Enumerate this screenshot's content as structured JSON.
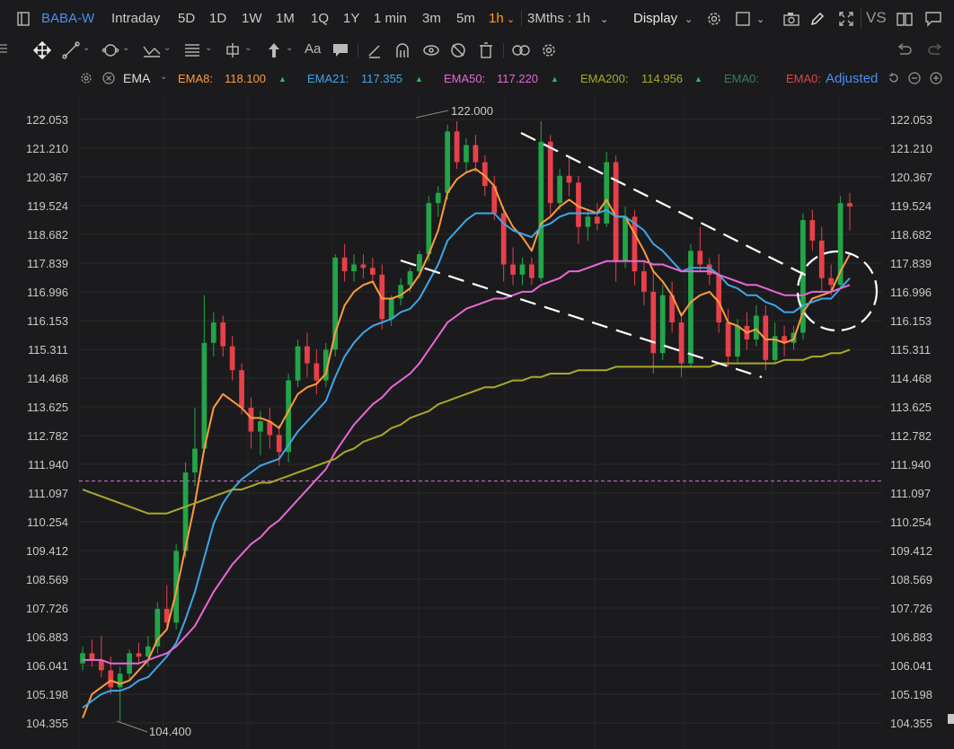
{
  "header": {
    "ticker": "BABA-W",
    "periods": [
      "Intraday",
      "5D",
      "1D",
      "1W",
      "1M",
      "1Q",
      "1Y",
      "1 min",
      "3m",
      "5m"
    ],
    "active_period": "1h",
    "range": "3Mths : 1h",
    "display": "Display",
    "vs": "VS"
  },
  "indicators": {
    "name": "EMA",
    "items": [
      {
        "label": "EMA8:",
        "value": "118.100",
        "color": "#ff9a3c"
      },
      {
        "label": "EMA21:",
        "value": "117.355",
        "color": "#3ea6e8"
      },
      {
        "label": "EMA50:",
        "value": "117.220",
        "color": "#e868d6"
      },
      {
        "label": "EMA200:",
        "value": "114.956",
        "color": "#a8a82a"
      }
    ],
    "extra1": "EMA0:",
    "extra2": "EMA0:",
    "adjusted": "Adjusted"
  },
  "axis": {
    "labels": [
      "122.053",
      "121.210",
      "120.367",
      "119.524",
      "118.682",
      "117.839",
      "116.996",
      "116.153",
      "115.311",
      "114.468",
      "113.625",
      "112.782",
      "111.940",
      "111.097",
      "110.254",
      "109.412",
      "108.569",
      "107.726",
      "106.883",
      "106.041",
      "105.198",
      "104.355"
    ]
  },
  "annotations": {
    "high": "122.000",
    "low": "104.400"
  },
  "chart_data": {
    "type": "candlestick",
    "y_range": [
      104.355,
      122.053
    ],
    "candles": [
      [
        106.1,
        106.6,
        105.9,
        106.4
      ],
      [
        106.4,
        106.8,
        106.0,
        106.2
      ],
      [
        106.2,
        106.9,
        105.7,
        105.9
      ],
      [
        105.9,
        106.3,
        105.2,
        105.4
      ],
      [
        105.4,
        106.0,
        104.4,
        105.8
      ],
      [
        105.8,
        106.5,
        105.6,
        106.4
      ],
      [
        106.4,
        106.7,
        106.1,
        106.3
      ],
      [
        106.3,
        106.9,
        106.0,
        106.6
      ],
      [
        106.6,
        107.9,
        106.4,
        107.7
      ],
      [
        107.7,
        108.4,
        107.2,
        107.3
      ],
      [
        107.3,
        109.6,
        107.1,
        109.4
      ],
      [
        109.4,
        112.0,
        109.2,
        111.7
      ],
      [
        111.7,
        113.6,
        111.3,
        112.4
      ],
      [
        112.4,
        116.9,
        112.3,
        115.5
      ],
      [
        115.5,
        116.4,
        115.1,
        116.1
      ],
      [
        116.1,
        116.3,
        115.1,
        115.4
      ],
      [
        115.4,
        115.7,
        114.4,
        114.7
      ],
      [
        114.7,
        114.9,
        113.4,
        113.6
      ],
      [
        113.6,
        113.9,
        112.4,
        112.9
      ],
      [
        112.9,
        113.5,
        112.2,
        113.2
      ],
      [
        113.2,
        113.6,
        112.4,
        112.8
      ],
      [
        112.8,
        113.1,
        111.9,
        112.3
      ],
      [
        112.3,
        114.6,
        112.0,
        114.4
      ],
      [
        114.4,
        115.6,
        114.2,
        115.4
      ],
      [
        115.4,
        115.8,
        114.5,
        114.9
      ],
      [
        114.9,
        115.3,
        114.0,
        114.4
      ],
      [
        114.4,
        115.5,
        114.2,
        115.3
      ],
      [
        115.3,
        118.1,
        115.1,
        118.0
      ],
      [
        118.0,
        118.4,
        117.3,
        117.6
      ],
      [
        117.6,
        118.1,
        117.3,
        117.8
      ],
      [
        117.8,
        118.1,
        117.4,
        117.7
      ],
      [
        117.7,
        118.0,
        117.3,
        117.5
      ],
      [
        117.5,
        117.8,
        115.9,
        116.2
      ],
      [
        116.2,
        116.9,
        116.0,
        116.8
      ],
      [
        116.8,
        117.4,
        116.6,
        117.2
      ],
      [
        117.2,
        117.7,
        117.0,
        117.6
      ],
      [
        117.6,
        118.2,
        117.4,
        118.1
      ],
      [
        118.1,
        119.8,
        117.9,
        119.6
      ],
      [
        119.6,
        120.1,
        119.2,
        119.9
      ],
      [
        119.9,
        121.9,
        119.7,
        121.7
      ],
      [
        121.7,
        122.0,
        120.6,
        120.8
      ],
      [
        120.8,
        121.5,
        120.5,
        121.3
      ],
      [
        121.3,
        121.6,
        120.5,
        120.8
      ],
      [
        120.8,
        121.0,
        119.8,
        120.1
      ],
      [
        120.1,
        120.4,
        119.1,
        119.3
      ],
      [
        119.3,
        119.5,
        117.3,
        117.8
      ],
      [
        117.8,
        118.3,
        117.2,
        117.5
      ],
      [
        117.5,
        118.0,
        117.2,
        117.8
      ],
      [
        117.8,
        118.0,
        117.2,
        117.4
      ],
      [
        117.4,
        122.0,
        117.3,
        121.4
      ],
      [
        121.4,
        121.6,
        119.2,
        119.6
      ],
      [
        119.6,
        120.6,
        119.4,
        120.4
      ],
      [
        120.4,
        121.0,
        119.8,
        120.2
      ],
      [
        120.2,
        120.4,
        118.4,
        118.9
      ],
      [
        118.9,
        119.4,
        118.5,
        119.2
      ],
      [
        119.2,
        119.6,
        118.8,
        119.0
      ],
      [
        119.0,
        121.1,
        118.9,
        120.8
      ],
      [
        120.8,
        121.0,
        117.3,
        117.9
      ],
      [
        117.9,
        119.5,
        117.7,
        119.2
      ],
      [
        119.2,
        119.4,
        117.2,
        117.6
      ],
      [
        117.6,
        117.9,
        116.6,
        117.0
      ],
      [
        117.0,
        117.6,
        114.6,
        115.2
      ],
      [
        115.2,
        117.2,
        115.0,
        116.9
      ],
      [
        116.9,
        117.3,
        115.8,
        116.1
      ],
      [
        116.1,
        116.4,
        114.5,
        114.9
      ],
      [
        114.9,
        118.4,
        114.8,
        118.2
      ],
      [
        118.2,
        118.9,
        117.6,
        117.8
      ],
      [
        117.8,
        118.0,
        117.2,
        117.5
      ],
      [
        117.5,
        118.1,
        115.8,
        116.1
      ],
      [
        116.1,
        116.5,
        114.8,
        115.1
      ],
      [
        115.1,
        116.2,
        114.9,
        116.0
      ],
      [
        116.0,
        116.4,
        115.3,
        115.6
      ],
      [
        115.6,
        116.6,
        115.4,
        116.3
      ],
      [
        116.3,
        116.6,
        114.7,
        115.0
      ],
      [
        115.0,
        116.1,
        114.9,
        115.7
      ],
      [
        115.7,
        116.0,
        115.1,
        115.5
      ],
      [
        115.5,
        116.0,
        115.3,
        115.8
      ],
      [
        115.8,
        119.3,
        115.6,
        119.1
      ],
      [
        119.1,
        119.4,
        118.2,
        118.5
      ],
      [
        118.5,
        118.9,
        117.0,
        117.4
      ],
      [
        117.4,
        117.8,
        116.9,
        117.2
      ],
      [
        117.2,
        119.8,
        117.1,
        119.6
      ],
      [
        119.6,
        119.9,
        118.8,
        119.5
      ]
    ],
    "series": [
      {
        "name": "EMA8",
        "values": [
          104.5,
          105.2,
          105.4,
          105.6,
          105.5,
          105.6,
          105.9,
          106.2,
          106.8,
          107.1,
          108.2,
          109.5,
          110.8,
          112.4,
          113.6,
          114.0,
          113.8,
          113.6,
          113.3,
          113.3,
          113.2,
          113.0,
          113.5,
          114.0,
          114.2,
          114.3,
          114.6,
          115.8,
          116.6,
          117.0,
          117.2,
          117.3,
          116.8,
          116.8,
          116.9,
          117.1,
          117.5,
          118.1,
          118.8,
          119.9,
          120.3,
          120.5,
          120.6,
          120.4,
          120.1,
          119.4,
          118.9,
          118.6,
          118.2,
          119.0,
          119.2,
          119.5,
          119.7,
          119.5,
          119.4,
          119.3,
          119.7,
          119.2,
          119.2,
          118.7,
          118.2,
          117.6,
          117.3,
          116.9,
          116.3,
          116.7,
          116.9,
          117.0,
          116.7,
          116.1,
          116.0,
          115.8,
          115.9,
          115.6,
          115.6,
          115.5,
          115.6,
          116.4,
          116.8,
          116.9,
          117.0,
          117.6,
          118.1
        ]
      },
      {
        "name": "EMA21",
        "values": [
          104.8,
          105.0,
          105.2,
          105.3,
          105.3,
          105.4,
          105.6,
          105.7,
          106.0,
          106.3,
          106.7,
          107.4,
          108.2,
          109.2,
          110.2,
          110.8,
          111.2,
          111.5,
          111.7,
          111.9,
          112.0,
          112.1,
          112.5,
          112.9,
          113.2,
          113.5,
          113.8,
          114.5,
          115.1,
          115.5,
          115.8,
          116.0,
          116.1,
          116.2,
          116.4,
          116.5,
          116.8,
          117.3,
          117.8,
          118.5,
          118.8,
          119.1,
          119.3,
          119.3,
          119.3,
          119.0,
          118.8,
          118.7,
          118.6,
          118.9,
          119.0,
          119.2,
          119.3,
          119.3,
          119.3,
          119.3,
          119.4,
          119.2,
          119.2,
          119.0,
          118.8,
          118.4,
          118.2,
          117.9,
          117.6,
          117.7,
          117.7,
          117.7,
          117.5,
          117.2,
          117.1,
          116.9,
          116.9,
          116.7,
          116.6,
          116.4,
          116.4,
          116.6,
          116.7,
          116.8,
          116.8,
          117.1,
          117.4
        ]
      },
      {
        "name": "EMA50",
        "values": [
          106.2,
          106.2,
          106.2,
          106.1,
          106.1,
          106.1,
          106.1,
          106.2,
          106.3,
          106.4,
          106.6,
          106.9,
          107.2,
          107.7,
          108.2,
          108.6,
          109.0,
          109.3,
          109.6,
          109.8,
          110.1,
          110.3,
          110.6,
          110.9,
          111.2,
          111.5,
          111.8,
          112.3,
          112.7,
          113.1,
          113.4,
          113.7,
          113.9,
          114.2,
          114.4,
          114.6,
          114.9,
          115.3,
          115.7,
          116.1,
          116.3,
          116.5,
          116.6,
          116.7,
          116.8,
          116.8,
          116.9,
          117.0,
          117.0,
          117.2,
          117.3,
          117.4,
          117.6,
          117.6,
          117.7,
          117.8,
          117.9,
          117.9,
          117.9,
          117.9,
          117.9,
          117.8,
          117.8,
          117.7,
          117.6,
          117.6,
          117.6,
          117.6,
          117.5,
          117.4,
          117.3,
          117.2,
          117.2,
          117.1,
          117.0,
          116.9,
          116.9,
          116.9,
          117.0,
          117.0,
          117.0,
          117.1,
          117.2
        ]
      },
      {
        "name": "EMA200",
        "values": [
          111.2,
          111.1,
          111.0,
          110.9,
          110.8,
          110.7,
          110.6,
          110.5,
          110.5,
          110.5,
          110.6,
          110.7,
          110.8,
          110.9,
          111.0,
          111.1,
          111.2,
          111.2,
          111.3,
          111.4,
          111.4,
          111.5,
          111.6,
          111.7,
          111.8,
          111.9,
          112.0,
          112.1,
          112.3,
          112.4,
          112.6,
          112.7,
          112.8,
          113.0,
          113.1,
          113.3,
          113.4,
          113.5,
          113.7,
          113.8,
          113.9,
          114.0,
          114.1,
          114.2,
          114.2,
          114.3,
          114.4,
          114.4,
          114.5,
          114.5,
          114.6,
          114.6,
          114.6,
          114.7,
          114.7,
          114.7,
          114.7,
          114.8,
          114.8,
          114.8,
          114.8,
          114.8,
          114.8,
          114.8,
          114.8,
          114.8,
          114.8,
          114.8,
          114.9,
          114.9,
          114.9,
          114.9,
          114.9,
          114.9,
          114.9,
          115.0,
          115.0,
          115.0,
          115.1,
          115.1,
          115.2,
          115.2,
          115.3
        ]
      }
    ],
    "reference_line": 111.45
  },
  "colors": {
    "up": "#22a548",
    "down": "#e8404a",
    "bg": "#1b1b1d",
    "grid": "#2b2b2e"
  }
}
